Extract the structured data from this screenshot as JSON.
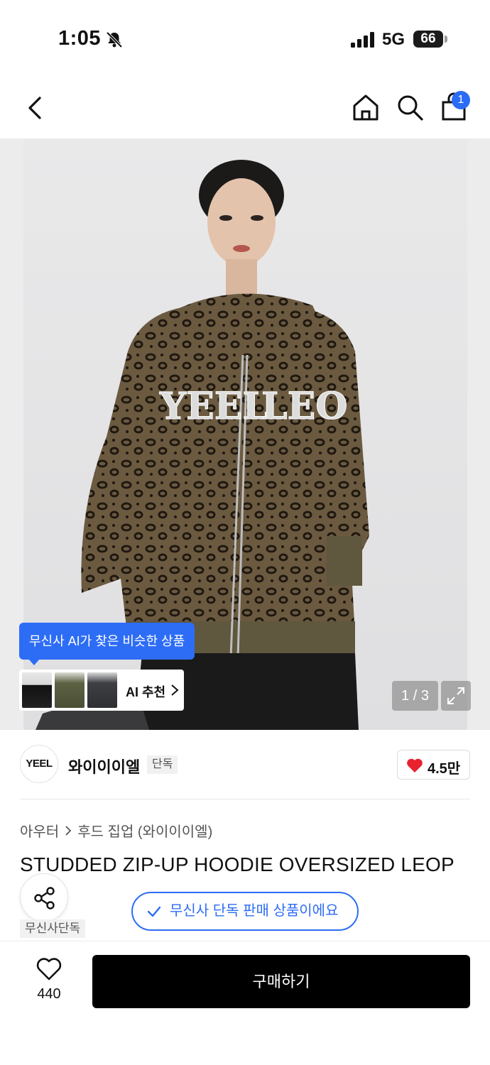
{
  "status_bar": {
    "time": "1:05",
    "network": "5G",
    "battery": "66"
  },
  "nav": {
    "cart_count": "1"
  },
  "hero": {
    "counter": "1 / 3"
  },
  "ai": {
    "tooltip": "무신사 AI가 찾은 비슷한 상품",
    "label": "AI 추천"
  },
  "brand": {
    "logo_text": "YEEL",
    "name": "와이이이엘",
    "tag": "단독",
    "likes": "4.5만"
  },
  "breadcrumb": {
    "category": "아우터",
    "subcategory": "후드 집업 (와이이이엘)"
  },
  "product": {
    "title": "STUDDED ZIP-UP HOODIE OVERSIZED LEOP"
  },
  "share": {
    "caption": "무신사단독"
  },
  "exclusive": {
    "label": "무신사 단독 판매 상품이에요"
  },
  "bottom": {
    "wish_count": "440",
    "buy_label": "구매하기"
  },
  "colors": {
    "accent": "#2d6df6",
    "heart": "#e8212e",
    "buy": "#000000"
  }
}
